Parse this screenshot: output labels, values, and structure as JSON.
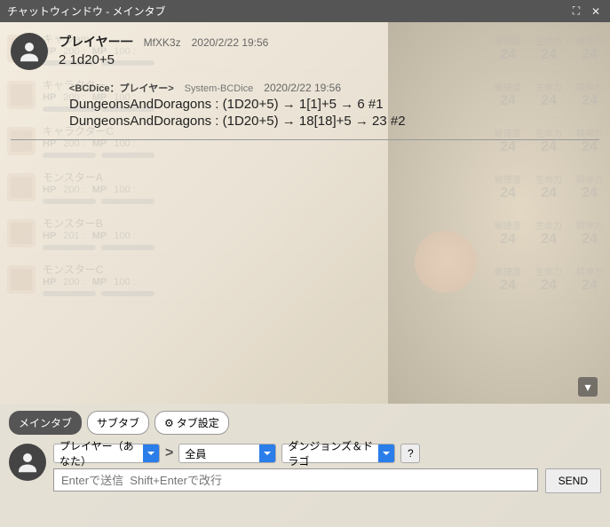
{
  "window": {
    "title": "チャットウィンドウ - メインタブ"
  },
  "messages": [
    {
      "name": "プレイヤー一",
      "id": "MfXK3z",
      "time": "2020/2/22 19:56",
      "text": "2 1d20+5"
    },
    {
      "prefix": "<BCDice：プレイヤー>",
      "system": "System-BCDice",
      "time": "2020/2/22 19:56",
      "lines": [
        "DungeonsAndDoragons : (1D20+5) → 1[1]+5 → 6 #1",
        "DungeonsAndDoragons : (1D20+5) → 18[18]+5 → 23 #2"
      ]
    }
  ],
  "characters": [
    {
      "name": "キャラam",
      "hp": "200 :",
      "mp": "100 :",
      "a1": "敏捷度",
      "a2": "生命力",
      "a3": "精神力",
      "v": "24"
    },
    {
      "name": "キャラクター",
      "hp": "200 :",
      "mp": "100 :",
      "a1": "敏捷度",
      "a2": "生命力",
      "a3": "精神力",
      "v": "24"
    },
    {
      "name": "キャラクターC",
      "hp": "200 :",
      "mp": "100 :",
      "a1": "敏捷度",
      "a2": "生命力",
      "a3": "精神力",
      "v": "24"
    },
    {
      "name": "モンスターA",
      "hp": "200 :",
      "mp": "100 :",
      "a1": "敏捷度",
      "a2": "生命力",
      "a3": "精神力",
      "v": "24"
    },
    {
      "name": "モンスターB",
      "hp": "201 :",
      "mp": "100 :",
      "a1": "敏捷度",
      "a2": "生命力",
      "a3": "精神力",
      "v": "24"
    },
    {
      "name": "モンスターC",
      "hp": "200 :",
      "mp": "100 :",
      "a1": "敏捷度",
      "a2": "生命力",
      "a3": "精神力",
      "v": "24"
    }
  ],
  "tabs": {
    "main": "メインタブ",
    "sub": "サブタブ",
    "settings": "タブ設定"
  },
  "compose": {
    "player_select": "プレイヤー（あなた）",
    "target_select": "全員",
    "system_select": "ダンジョンズ＆ドラゴ",
    "help": "?",
    "placeholder": "Enterで送信  Shift+Enterで改行",
    "send": "SEND"
  }
}
